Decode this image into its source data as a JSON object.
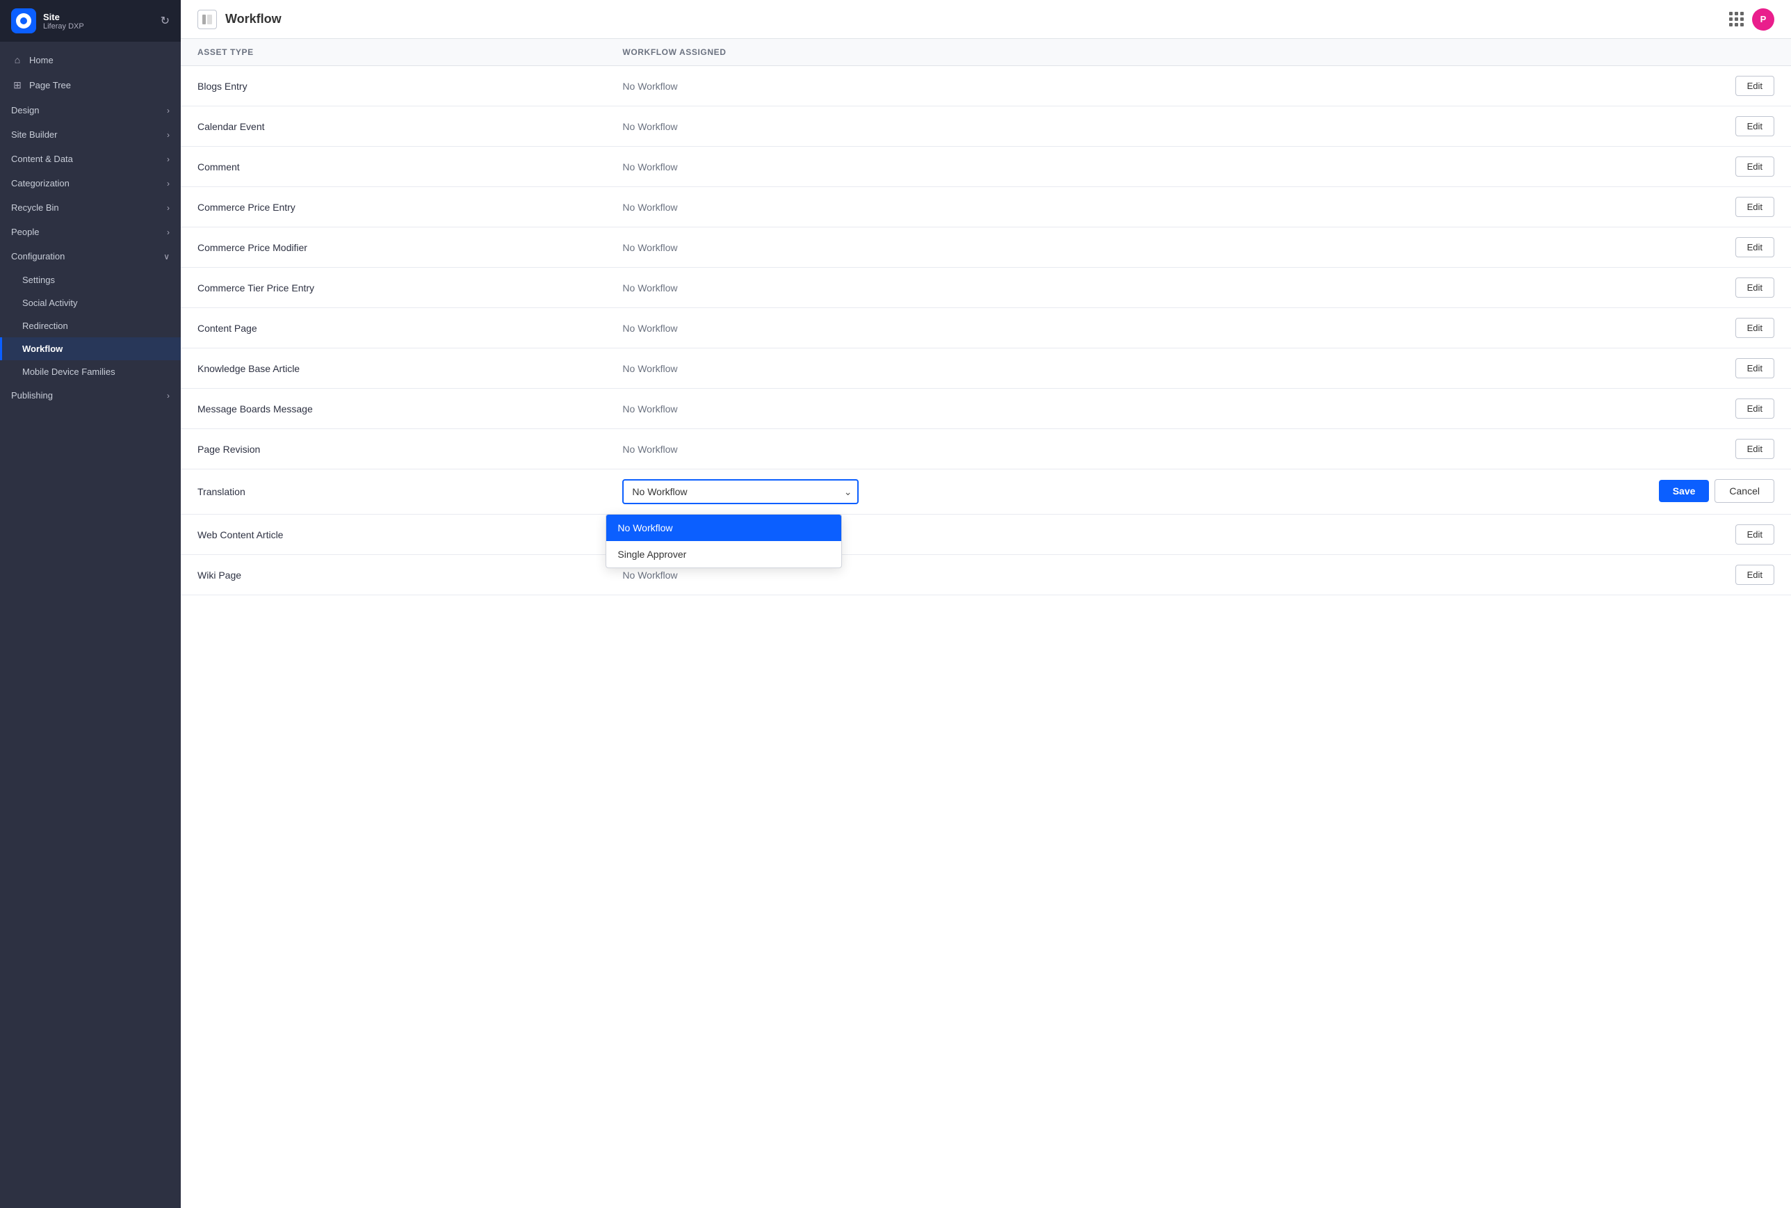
{
  "sidebar": {
    "site_name": "Site",
    "site_sub": "Liferay DXP",
    "items": [
      {
        "id": "home",
        "label": "Home",
        "icon": "⌂",
        "type": "item"
      },
      {
        "id": "page-tree",
        "label": "Page Tree",
        "icon": "⊞",
        "type": "item"
      },
      {
        "id": "design",
        "label": "Design",
        "type": "section"
      },
      {
        "id": "site-builder",
        "label": "Site Builder",
        "type": "section"
      },
      {
        "id": "content-data",
        "label": "Content & Data",
        "type": "section"
      },
      {
        "id": "categorization",
        "label": "Categorization",
        "type": "section"
      },
      {
        "id": "recycle-bin",
        "label": "Recycle Bin",
        "type": "section"
      },
      {
        "id": "people",
        "label": "People",
        "type": "section"
      },
      {
        "id": "configuration",
        "label": "Configuration",
        "type": "section-open"
      }
    ],
    "sub_items": [
      {
        "id": "settings",
        "label": "Settings"
      },
      {
        "id": "social-activity",
        "label": "Social Activity"
      },
      {
        "id": "redirection",
        "label": "Redirection"
      },
      {
        "id": "workflow",
        "label": "Workflow",
        "active": true
      },
      {
        "id": "mobile-device-families",
        "label": "Mobile Device Families"
      }
    ],
    "publishing": {
      "label": "Publishing"
    }
  },
  "topbar": {
    "title": "Workflow",
    "panel_icon": "▣"
  },
  "table": {
    "headers": [
      {
        "id": "asset-type",
        "label": "Asset Type"
      },
      {
        "id": "workflow-assigned",
        "label": "Workflow Assigned"
      }
    ],
    "rows": [
      {
        "asset_type": "Blogs Entry",
        "workflow": "No Workflow",
        "editing": false
      },
      {
        "asset_type": "Calendar Event",
        "workflow": "No Workflow",
        "editing": false
      },
      {
        "asset_type": "Comment",
        "workflow": "No Workflow",
        "editing": false
      },
      {
        "asset_type": "Commerce Price Entry",
        "workflow": "No Workflow",
        "editing": false
      },
      {
        "asset_type": "Commerce Price Modifier",
        "workflow": "No Workflow",
        "editing": false
      },
      {
        "asset_type": "Commerce Tier Price Entry",
        "workflow": "No Workflow",
        "editing": false
      },
      {
        "asset_type": "Content Page",
        "workflow": "No Workflow",
        "editing": false
      },
      {
        "asset_type": "Knowledge Base Article",
        "workflow": "No Workflow",
        "editing": false
      },
      {
        "asset_type": "Message Boards Message",
        "workflow": "No Workflow",
        "editing": false
      },
      {
        "asset_type": "Page Revision",
        "workflow": "No Workflow",
        "editing": false
      },
      {
        "asset_type": "Translation",
        "workflow": "No Workflow",
        "editing": true
      },
      {
        "asset_type": "Web Content Article",
        "workflow": "No Workflow",
        "editing": false
      },
      {
        "asset_type": "Wiki Page",
        "workflow": "No Workflow",
        "editing": false
      }
    ],
    "dropdown": {
      "options": [
        {
          "value": "no-workflow",
          "label": "No Workflow",
          "selected": true
        },
        {
          "value": "single-approver",
          "label": "Single Approver",
          "selected": false
        }
      ]
    },
    "save_label": "Save",
    "cancel_label": "Cancel",
    "edit_label": "Edit"
  },
  "colors": {
    "brand_blue": "#0b5fff",
    "sidebar_bg": "#2d3142",
    "active_item": "#0b5fff"
  }
}
